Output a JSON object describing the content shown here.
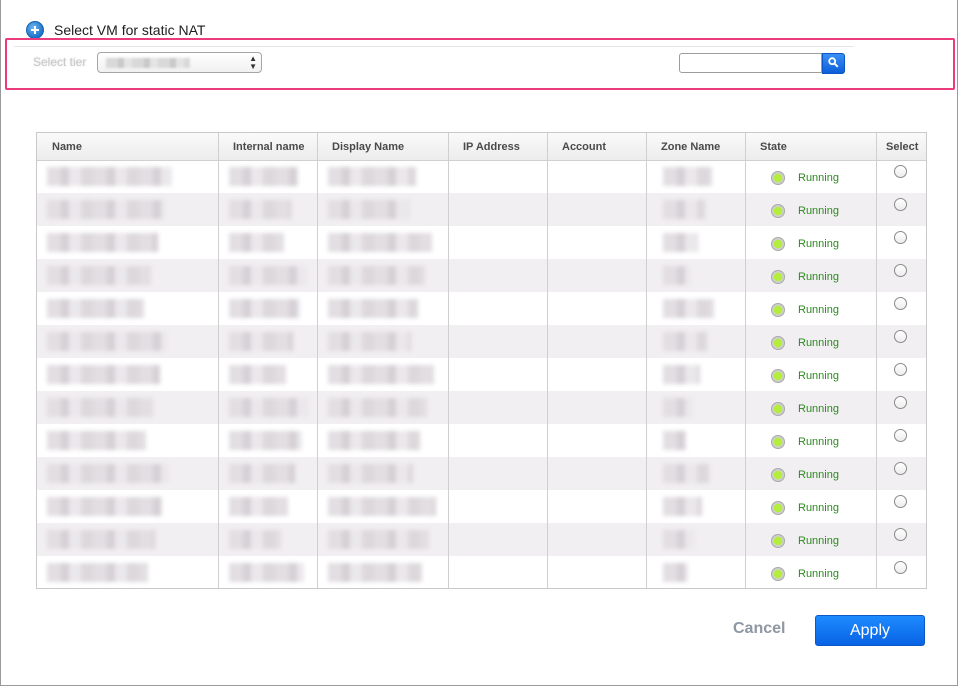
{
  "dialog": {
    "title": "Select VM for static NAT",
    "icon": "plus-circle-icon"
  },
  "filter": {
    "tier_label": "Select tier",
    "search_value": "",
    "search_icon": "magnifier-icon"
  },
  "table": {
    "columns": [
      "Name",
      "Internal name",
      "Display Name",
      "IP Address",
      "Account",
      "Zone Name",
      "State",
      "Select"
    ],
    "rows": [
      {
        "state": "Running"
      },
      {
        "state": "Running"
      },
      {
        "state": "Running"
      },
      {
        "state": "Running"
      },
      {
        "state": "Running"
      },
      {
        "state": "Running"
      },
      {
        "state": "Running"
      },
      {
        "state": "Running"
      },
      {
        "state": "Running"
      },
      {
        "state": "Running"
      },
      {
        "state": "Running"
      },
      {
        "state": "Running"
      },
      {
        "state": "Running"
      }
    ]
  },
  "actions": {
    "cancel_label": "Cancel",
    "apply_label": "Apply"
  },
  "colors": {
    "highlight": "#ec3b7d",
    "running": "#2c8a1f",
    "primary": "#0d6fe8"
  }
}
